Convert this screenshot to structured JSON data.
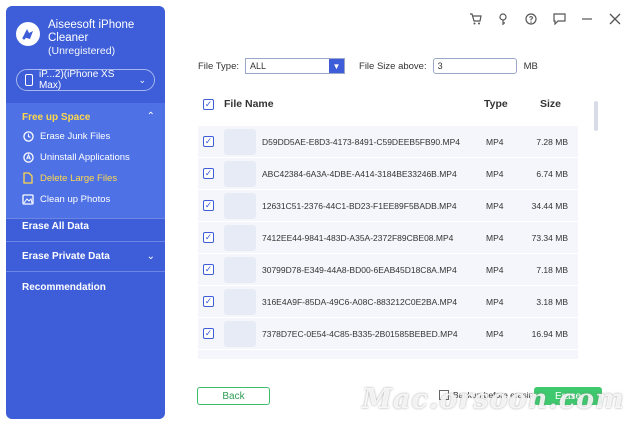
{
  "app": {
    "title_line1": "Aiseesoft iPhone",
    "title_line2": "Cleaner",
    "subtitle": "(Unregistered)"
  },
  "device": {
    "label": "iP...2)(iPhone XS Max)"
  },
  "sidebar": {
    "sections": [
      {
        "title": "Free up Space",
        "expanded": true,
        "items": [
          {
            "label": "Erase Junk Files",
            "icon": "clock-icon"
          },
          {
            "label": "Uninstall Applications",
            "icon": "apps-icon"
          },
          {
            "label": "Delete Large Files",
            "icon": "file-icon",
            "active": true
          },
          {
            "label": "Clean up Photos",
            "icon": "photo-icon"
          }
        ]
      },
      {
        "title": "Erase All Data"
      },
      {
        "title": "Erase Private Data"
      },
      {
        "title": "Recommendation"
      }
    ]
  },
  "filters": {
    "file_type_label": "File Type:",
    "file_type_value": "ALL",
    "file_size_label": "File Size above:",
    "file_size_value": "3",
    "unit": "MB"
  },
  "table": {
    "columns": {
      "name": "File Name",
      "type": "Type",
      "size": "Size"
    },
    "rows": [
      {
        "name": "D59DD5AE-E8D3-4173-8491-C59DEEB5FB90.MP4",
        "type": "MP4",
        "size": "7.28 MB"
      },
      {
        "name": "ABC42384-6A3A-4DBE-A414-3184BE33246B.MP4",
        "type": "MP4",
        "size": "6.74 MB"
      },
      {
        "name": "12631C51-2376-44C1-BD23-F1EE89F5BADB.MP4",
        "type": "MP4",
        "size": "34.44 MB"
      },
      {
        "name": "7412EE44-9841-483D-A35A-2372F89CBE08.MP4",
        "type": "MP4",
        "size": "73.34 MB"
      },
      {
        "name": "30799D78-E349-44A8-BD00-6EAB45D18C8A.MP4",
        "type": "MP4",
        "size": "7.18 MB"
      },
      {
        "name": "316E4A9F-85DA-49C6-A08C-883212C0E2BA.MP4",
        "type": "MP4",
        "size": "3.18 MB"
      },
      {
        "name": "7378D7EC-0E54-4C85-B335-2B01585BEBED.MP4",
        "type": "MP4",
        "size": "16.94 MB"
      }
    ]
  },
  "footer": {
    "back_label": "Back",
    "backup_label": "Backup before erasing",
    "erase_label": "Erase",
    "watermark": "Mac.orsoon.com"
  },
  "colors": {
    "sidebar": "#3d5ed8",
    "accent_yellow": "#ffd84a",
    "erase_green": "#3ec96e"
  }
}
